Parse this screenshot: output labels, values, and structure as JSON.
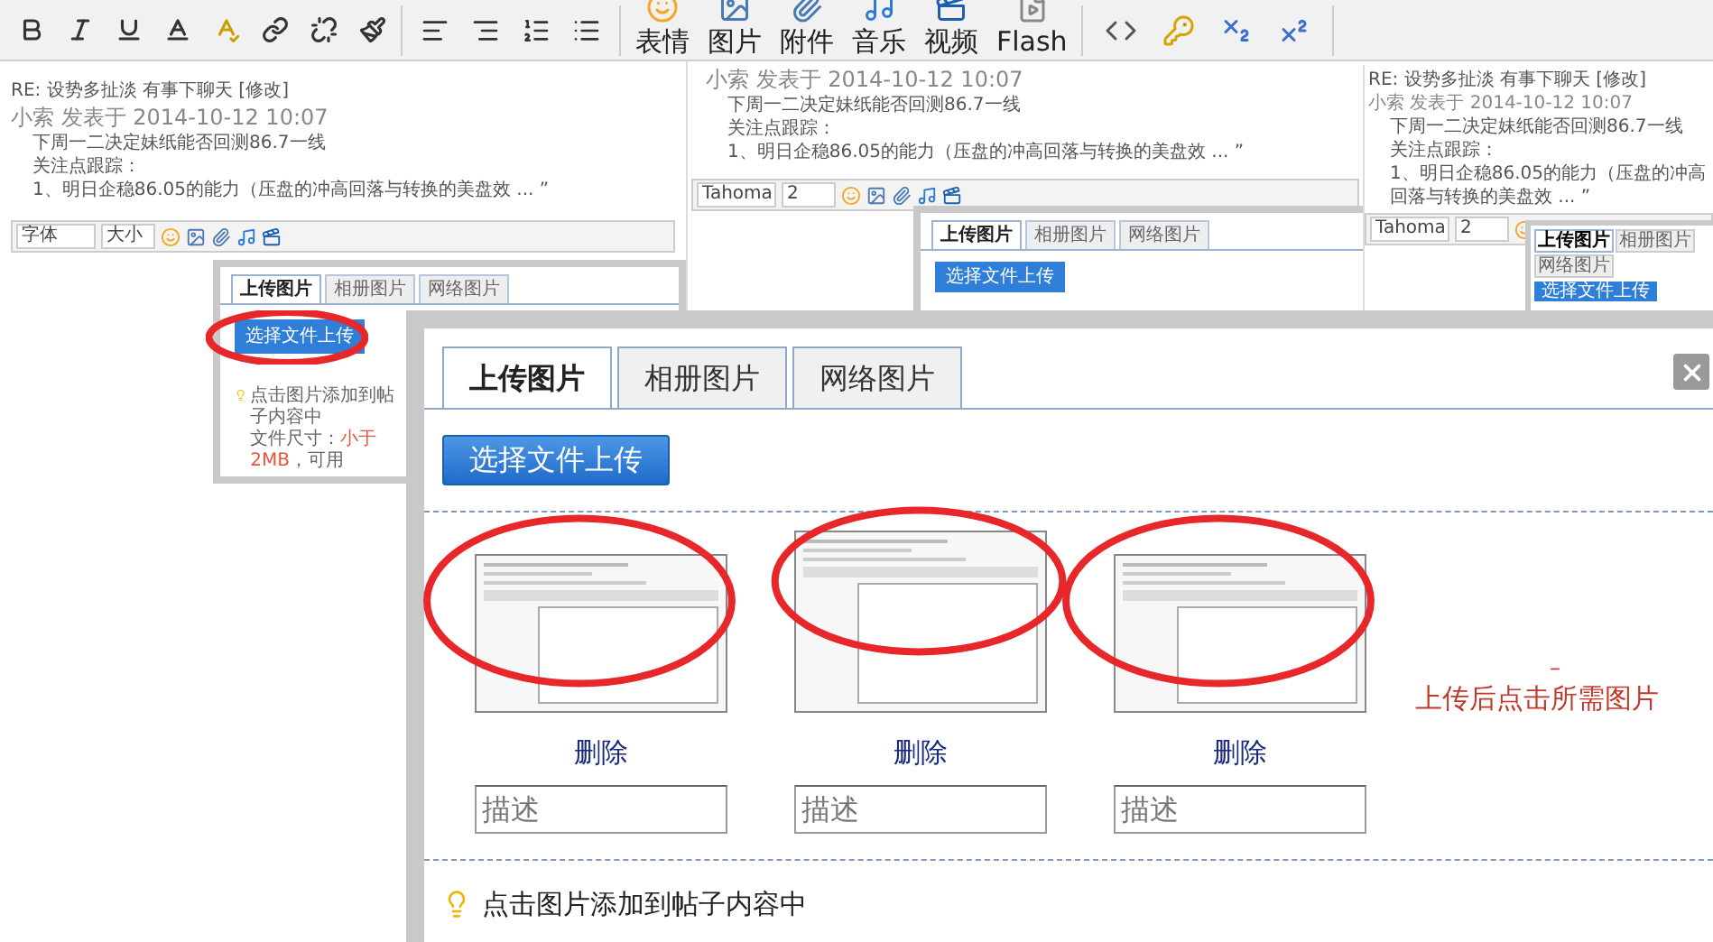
{
  "toolbar": {
    "media_buttons": [
      {
        "label": "表情"
      },
      {
        "label": "图片"
      },
      {
        "label": "附件"
      },
      {
        "label": "音乐"
      },
      {
        "label": "视频"
      },
      {
        "label": "Flash"
      }
    ]
  },
  "background_left": {
    "title": "RE: 设势多扯淡 有事下聊天 [修改]",
    "quote_header": "小索 发表于 2014-10-12 10:07",
    "lines": [
      "下周一二决定妹纸能否回测86.7一线",
      "关注点跟踪：",
      "1、明日企稳86.05的能力（压盘的冲高回落与转换的美盘效 ... ”"
    ],
    "font_select": "字体",
    "size_select": "大小",
    "dialog": {
      "tabs": [
        {
          "label": "上传图片",
          "selected": true
        },
        {
          "label": "相册图片",
          "selected": false
        },
        {
          "label": "网络图片",
          "selected": false
        }
      ],
      "upload_button": "选择文件上传",
      "hint": "点击图片添加到帖子内容中",
      "size_prefix": "文件尺寸：",
      "size_limit": "小于 2MB",
      "size_suffix": "，可用"
    }
  },
  "background_middle": {
    "quote_header": "小索 发表于 2014-10-12 10:07",
    "lines": [
      "下周一二决定妹纸能否回测86.7一线",
      "关注点跟踪：",
      "1、明日企稳86.05的能力（压盘的冲高回落与转换的美盘效 ... ”"
    ],
    "font_select": "Tahoma",
    "size_select": "2",
    "dialog": {
      "tabs": [
        {
          "label": "上传图片",
          "selected": true
        },
        {
          "label": "相册图片",
          "selected": false
        },
        {
          "label": "网络图片",
          "selected": false
        }
      ],
      "upload_button": "选择文件上传"
    }
  },
  "background_right": {
    "title": "RE: 设势多扯淡 有事下聊天 [修改]",
    "quote_header": "小索 发表于 2014-10-12 10:07",
    "lines": [
      "下周一二决定妹纸能否回测86.7一线",
      "关注点跟踪：",
      "1、明日企稳86.05的能力（压盘的冲高回落与转换的美盘效 ... ”"
    ],
    "font_select": "Tahoma",
    "size_select": "2",
    "dialog": {
      "tabs": [
        {
          "label": "上传图片",
          "selected": true
        },
        {
          "label": "相册图片",
          "selected": false
        },
        {
          "label": "网络图片",
          "selected": false
        }
      ],
      "upload_button": "选择文件上传"
    }
  },
  "dialog": {
    "tabs": [
      {
        "label": "上传图片",
        "selected": true
      },
      {
        "label": "相册图片",
        "selected": false
      },
      {
        "label": "网络图片",
        "selected": false
      }
    ],
    "upload_button": "选择文件上传",
    "images": [
      {
        "delete_label": "删除",
        "description_placeholder": "描述"
      },
      {
        "delete_label": "删除",
        "description_placeholder": "描述"
      },
      {
        "delete_label": "删除",
        "description_placeholder": "描述"
      }
    ],
    "annotation_mark": "–",
    "annotation": "上传后点击所需图片",
    "hint": "点击图片添加到帖子内容中"
  }
}
